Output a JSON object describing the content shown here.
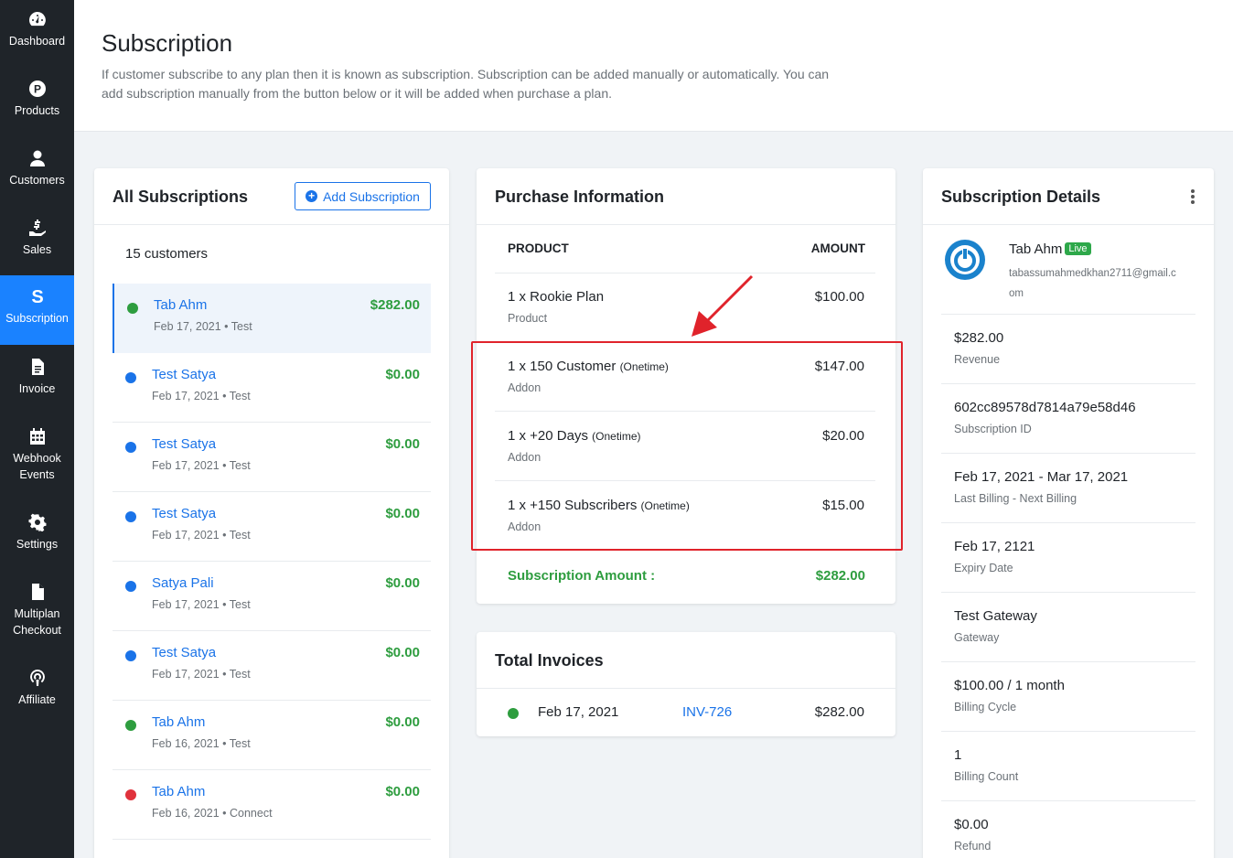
{
  "sidebar": {
    "items": [
      {
        "label": "Dashboard",
        "icon": "dashboard-icon"
      },
      {
        "label": "Products",
        "icon": "products-icon"
      },
      {
        "label": "Customers",
        "icon": "customers-icon"
      },
      {
        "label": "Sales",
        "icon": "sales-icon"
      },
      {
        "label": "Subscription",
        "icon": "subscription-icon",
        "active": true
      },
      {
        "label": "Invoice",
        "icon": "invoice-icon"
      },
      {
        "label": "Webhook Events",
        "icon": "calendar-icon"
      },
      {
        "label": "Settings",
        "icon": "gear-icon"
      },
      {
        "label": "Multiplan Checkout",
        "icon": "file-icon"
      },
      {
        "label": "Affiliate",
        "icon": "broadcast-icon"
      }
    ]
  },
  "header": {
    "title": "Subscription",
    "description": "If customer subscribe to any plan then it is known as subscription. Subscription can be added manually or automatically. You can add subscription manually from the button below or it will be added when purchase a plan."
  },
  "subscriptions": {
    "title": "All Subscriptions",
    "add_label": "Add Subscription",
    "count_label": "15 customers",
    "rows": [
      {
        "name": "Tab Ahm",
        "date": "Feb 17, 2021",
        "mode": "• Test",
        "amount": "$282.00",
        "status_color": "#2e9d3f"
      },
      {
        "name": "Test Satya",
        "date": "Feb 17, 2021",
        "mode": "• Test",
        "amount": "$0.00",
        "status_color": "#1a73e8"
      },
      {
        "name": "Test Satya",
        "date": "Feb 17, 2021",
        "mode": "• Test",
        "amount": "$0.00",
        "status_color": "#1a73e8"
      },
      {
        "name": "Test Satya",
        "date": "Feb 17, 2021",
        "mode": "• Test",
        "amount": "$0.00",
        "status_color": "#1a73e8"
      },
      {
        "name": "Satya Pali",
        "date": "Feb 17, 2021",
        "mode": "• Test",
        "amount": "$0.00",
        "status_color": "#1a73e8"
      },
      {
        "name": "Test Satya",
        "date": "Feb 17, 2021",
        "mode": "• Test",
        "amount": "$0.00",
        "status_color": "#1a73e8"
      },
      {
        "name": "Tab Ahm",
        "date": "Feb 16, 2021",
        "mode": "• Test",
        "amount": "$0.00",
        "status_color": "#2e9d3f"
      },
      {
        "name": "Tab Ahm",
        "date": "Feb 16, 2021",
        "mode": "• Connect",
        "amount": "$0.00",
        "status_color": "#e0323c"
      }
    ]
  },
  "purchase": {
    "title": "Purchase Information",
    "col_product": "PRODUCT",
    "col_amount": "AMOUNT",
    "lines": [
      {
        "product": "1 x Rookie Plan",
        "note": "",
        "type": "Product",
        "amount": "$100.00"
      },
      {
        "product": "1 x 150 Customer",
        "note": "(Onetime)",
        "type": "Addon",
        "amount": "$147.00"
      },
      {
        "product": "1 x +20 Days",
        "note": "(Onetime)",
        "type": "Addon",
        "amount": "$20.00"
      },
      {
        "product": "1 x +150 Subscribers",
        "note": "(Onetime)",
        "type": "Addon",
        "amount": "$15.00"
      }
    ],
    "total_label": "Subscription Amount :",
    "total_value": "$282.00"
  },
  "invoices": {
    "title": "Total Invoices",
    "rows": [
      {
        "date": "Feb 17, 2021",
        "number": "INV-726",
        "amount": "$282.00"
      }
    ]
  },
  "details": {
    "title": "Subscription Details",
    "customer_name": "Tab Ahm",
    "status_badge": "Live",
    "email_line1": "tabassumahmedkhan2711@gmail.c",
    "email_line2": "om",
    "rows": [
      {
        "value": "$282.00",
        "label": "Revenue"
      },
      {
        "value": "602cc89578d7814a79e58d46",
        "label": "Subscription ID"
      },
      {
        "value": "Feb 17, 2021 - Mar 17, 2021",
        "label": "Last Billing - Next Billing"
      },
      {
        "value": "Feb 17, 2121",
        "label": "Expiry Date"
      },
      {
        "value": "Test Gateway",
        "label": "Gateway"
      },
      {
        "value": "$100.00 / 1 month",
        "label": "Billing Cycle"
      },
      {
        "value": "1",
        "label": "Billing Count"
      },
      {
        "value": "$0.00",
        "label": "Refund"
      }
    ]
  },
  "colors": {
    "sidebar_bg": "#1f2429",
    "accent": "#1a82ff",
    "success": "#2e9d3f",
    "highlight": "#e0232b"
  }
}
